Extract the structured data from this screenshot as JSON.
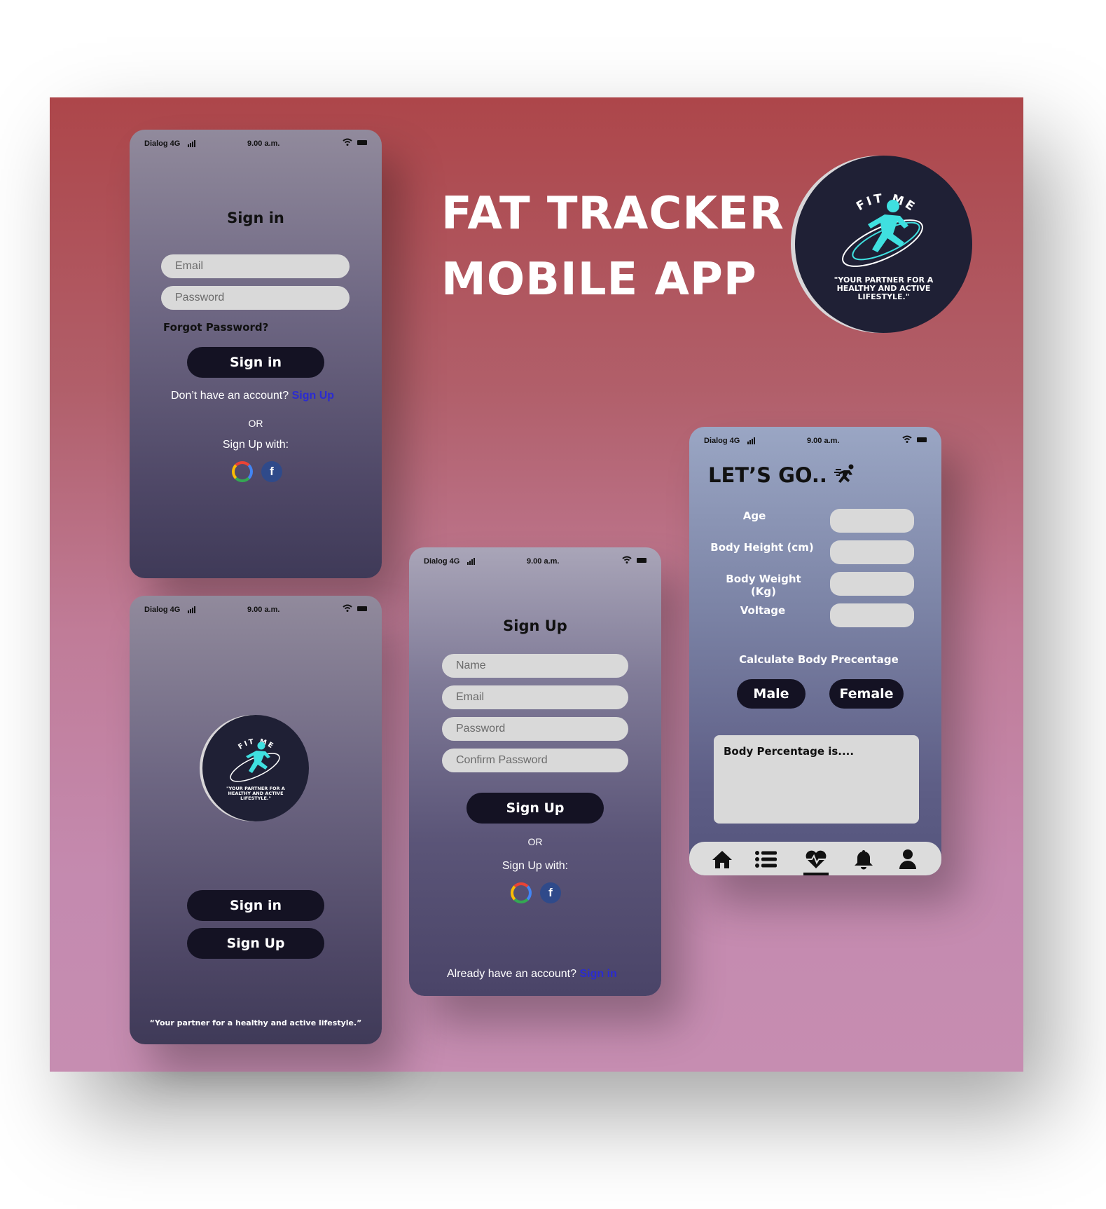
{
  "headline": {
    "line1": "FAT TRACKER",
    "line2": "MOBILE APP"
  },
  "logo": {
    "brand": "FIT ME",
    "tagline": "\"YOUR PARTNER FOR A HEALTHY AND ACTIVE LIFESTYLE.\""
  },
  "status_bar": {
    "carrier": "Dialog 4G",
    "time": "9.00 a.m."
  },
  "signin_screen": {
    "title": "Sign in",
    "email_placeholder": "Email",
    "password_placeholder": "Password",
    "forgot": "Forgot Password?",
    "button": "Sign in",
    "no_account": "Don’t have an account?",
    "signup_link": "Sign Up",
    "or": "OR",
    "signup_with": "Sign Up with:"
  },
  "splash_screen": {
    "signin_button": "Sign in",
    "signup_button": "Sign Up",
    "footer_quote": "“Your partner for a healthy and active lifestyle.”"
  },
  "signup_screen": {
    "title": "Sign Up",
    "name_placeholder": "Name",
    "email_placeholder": "Email",
    "password_placeholder": "Password",
    "confirm_placeholder": "Confirm Password",
    "button": "Sign Up",
    "or": "OR",
    "signup_with": "Sign Up with:",
    "already": "Already have an account?",
    "signin_link": "Sign in"
  },
  "calc_screen": {
    "title": "LET’S GO..",
    "age_label": "Age",
    "height_label": "Body Height (cm)",
    "weight_label": "Body Weight (Kg)",
    "voltage_label": "Voltage",
    "calc_label": "Calculate Body Precentage",
    "male_button": "Male",
    "female_button": "Female",
    "result_label": "Body Percentage is....",
    "nav": [
      "home-icon",
      "list-icon",
      "heart-pulse-icon",
      "bell-icon",
      "user-icon"
    ],
    "active_nav": "heart-pulse-icon"
  },
  "colors": {
    "button": "#141223",
    "link": "#2b2bd1",
    "logo_bg": "#1f2035",
    "accent": "#3fe0e0"
  }
}
